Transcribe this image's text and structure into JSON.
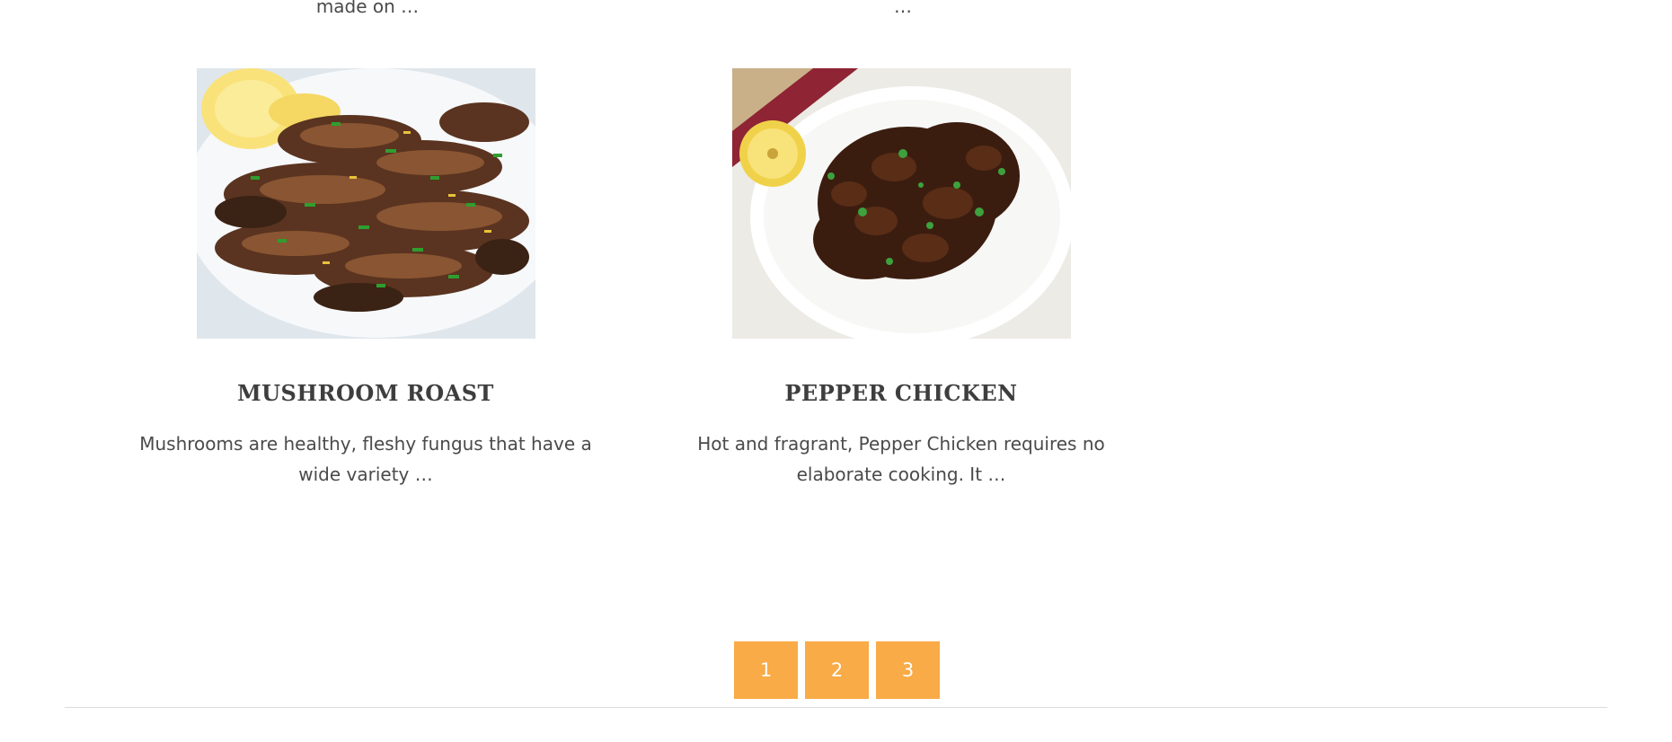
{
  "previous_row": {
    "snippet_left": "made on …",
    "snippet_right": "…"
  },
  "posts": [
    {
      "title": "MUSHROOM ROAST",
      "excerpt": "Mushrooms are healthy, fleshy fungus that have a wide variety …",
      "image_icon": "mushroom-roast-photo"
    },
    {
      "title": "PEPPER CHICKEN",
      "excerpt": "Hot and fragrant, Pepper Chicken requires no elaborate cooking. It …",
      "image_icon": "pepper-chicken-photo"
    }
  ],
  "pagination": {
    "pages": [
      "1",
      "2",
      "3"
    ],
    "accent_color": "#f9ab47"
  }
}
